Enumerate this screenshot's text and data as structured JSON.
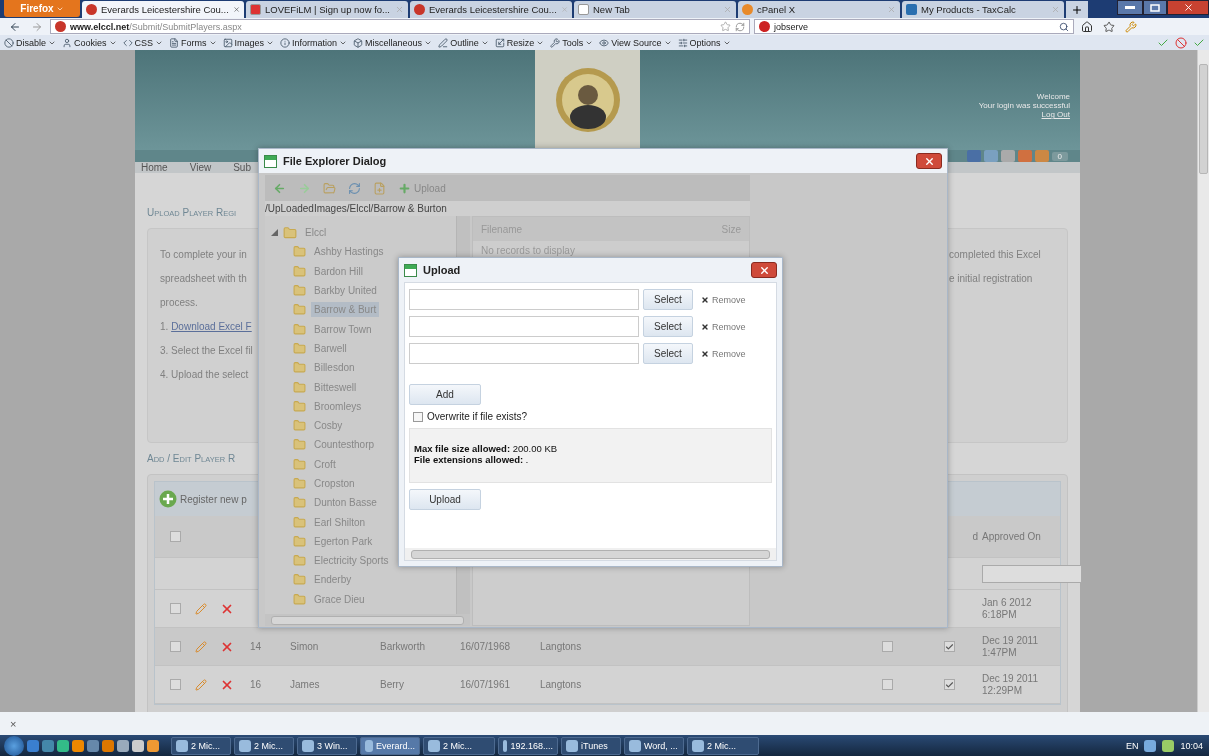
{
  "browser": {
    "app_button": "Firefox",
    "tabs": [
      {
        "title": "Everards Leicestershire Cou...",
        "selected": true
      },
      {
        "title": "LOVEFiLM | Sign up now fo...",
        "selected": false
      },
      {
        "title": "Everards Leicestershire Cou...",
        "selected": false
      },
      {
        "title": "New Tab",
        "selected": false
      },
      {
        "title": "cPanel X",
        "selected": false
      },
      {
        "title": "My Products - TaxCalc",
        "selected": false
      }
    ],
    "url": {
      "host": "www.elccl.net",
      "path": "/Submit/SubmitPlayers.aspx"
    },
    "search": "jobserve",
    "dev_toolbar": [
      "Disable",
      "Cookies",
      "CSS",
      "Forms",
      "Images",
      "Information",
      "Miscellaneous",
      "Outline",
      "Resize",
      "Tools",
      "View Source",
      "Options"
    ]
  },
  "page": {
    "welcome": "Welcome",
    "login_message": "Your login was successful",
    "logout": "Log Out",
    "social_count": "0",
    "nav": [
      "Home",
      "View",
      "Sub"
    ],
    "upload_heading": "UPLOAD PLAYER REGI",
    "instructions_left": [
      "To complete your in",
      "spreadsheet with th",
      "process."
    ],
    "download_prefix": "1. ",
    "download_link": "Download Excel F",
    "steps": [
      "3. Select the Excel fil",
      "4. Upload the select"
    ],
    "instructions_right": [
      "completed this Excel",
      "e initial registration"
    ],
    "edit_heading": "ADD / EDIT PLAYER R",
    "register_button": "Register new p",
    "grid": {
      "select_all_checked": false,
      "column_partial": "d",
      "approved_header": "Approved On",
      "rows": [
        {
          "checked": false,
          "id": "",
          "first": "",
          "last": "",
          "dob": "",
          "club": "",
          "approved": [
            "Jan 6 2012",
            "6:18PM"
          ]
        },
        {
          "checked": false,
          "id": "14",
          "first": "Simon",
          "last": "Barkworth",
          "dob": "16/07/1968",
          "club": "Langtons",
          "check_a": false,
          "check_b": true,
          "approved": [
            "Dec 19 2011",
            "1:47PM"
          ]
        },
        {
          "checked": false,
          "id": "16",
          "first": "James",
          "last": "Berry",
          "dob": "16/07/1961",
          "club": "Langtons",
          "check_a": false,
          "check_b": true,
          "approved": [
            "Dec 19 2011",
            "12:29PM"
          ]
        }
      ]
    }
  },
  "file_explorer": {
    "title": "File Explorer Dialog",
    "upload_button": "Upload",
    "path": "/UpLoadedImages/Elccl/Barrow & Burton",
    "tree": {
      "label": "Elccl",
      "expanded": true,
      "children": [
        {
          "label": "Ashby Hastings",
          "selected": false
        },
        {
          "label": "Bardon Hill",
          "selected": false
        },
        {
          "label": "Barkby United",
          "selected": false
        },
        {
          "label": "Barrow & Burt",
          "selected": true
        },
        {
          "label": "Barrow Town",
          "selected": false
        },
        {
          "label": "Barwell",
          "selected": false
        },
        {
          "label": "Billesdon",
          "selected": false
        },
        {
          "label": "Bitteswell",
          "selected": false
        },
        {
          "label": "Broomleys",
          "selected": false
        },
        {
          "label": "Cosby",
          "selected": false
        },
        {
          "label": "Countesthorp",
          "selected": false
        },
        {
          "label": "Croft",
          "selected": false
        },
        {
          "label": "Cropston",
          "selected": false
        },
        {
          "label": "Dunton Basse",
          "selected": false
        },
        {
          "label": "Earl Shilton",
          "selected": false
        },
        {
          "label": "Egerton Park",
          "selected": false
        },
        {
          "label": "Electricity Sports",
          "selected": false
        },
        {
          "label": "Enderby",
          "selected": false
        },
        {
          "label": "Grace Dieu",
          "selected": false
        }
      ]
    },
    "columns": [
      "Filename",
      "Size"
    ],
    "empty_message": "No records to display"
  },
  "upload_dialog": {
    "title": "Upload",
    "rows": [
      {
        "select": "Select",
        "remove": "Remove"
      },
      {
        "select": "Select",
        "remove": "Remove"
      },
      {
        "select": "Select",
        "remove": "Remove"
      }
    ],
    "add_button": "Add",
    "overwrite": {
      "label": "Overwrite if file exists?",
      "checked": false
    },
    "info": [
      "**Max file size allowed:** 200.00 KB",
      "**File extensions allowed:** *.*"
    ],
    "upload_button": "Upload"
  },
  "find_bar": {
    "close": "×"
  },
  "taskbar": {
    "items": [
      {
        "label": "2 Mic...",
        "active": false
      },
      {
        "label": "2 Mic...",
        "active": false
      },
      {
        "label": "3 Win...",
        "active": false
      },
      {
        "label": "Everard...",
        "active": true
      },
      {
        "label": "2 Mic...",
        "active": false
      },
      {
        "label": "192.168....",
        "active": false
      },
      {
        "label": "iTunes",
        "active": false
      },
      {
        "label": "Word, ...",
        "active": false
      },
      {
        "label": "2 Mic...",
        "active": false
      }
    ],
    "language": "EN",
    "clock": "10:04"
  }
}
